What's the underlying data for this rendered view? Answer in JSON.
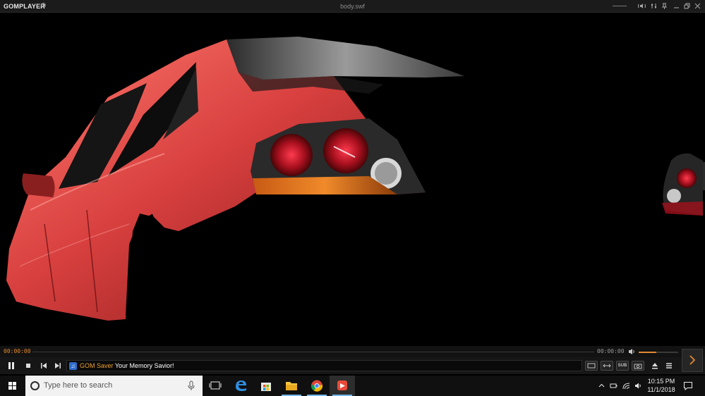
{
  "app": {
    "logo_text": "GOMPLAYER",
    "window_title": "body.swf"
  },
  "playback": {
    "current_time": "00:00:00",
    "total_time": "00:00:00",
    "volume_level": 0.45,
    "state": "playing"
  },
  "ticker": {
    "brand": "GOM Saver",
    "message": " Your Memory Savior!"
  },
  "option_buttons": {
    "sub_label": "SUB"
  },
  "taskbar": {
    "search_placeholder": "Type here to search",
    "clock_time": "10:15 PM",
    "clock_date": "11/1/2018"
  },
  "colors": {
    "accent": "#e08a2e",
    "car_body": "#d8403f",
    "taskbar_highlight": "#76b9ed"
  }
}
